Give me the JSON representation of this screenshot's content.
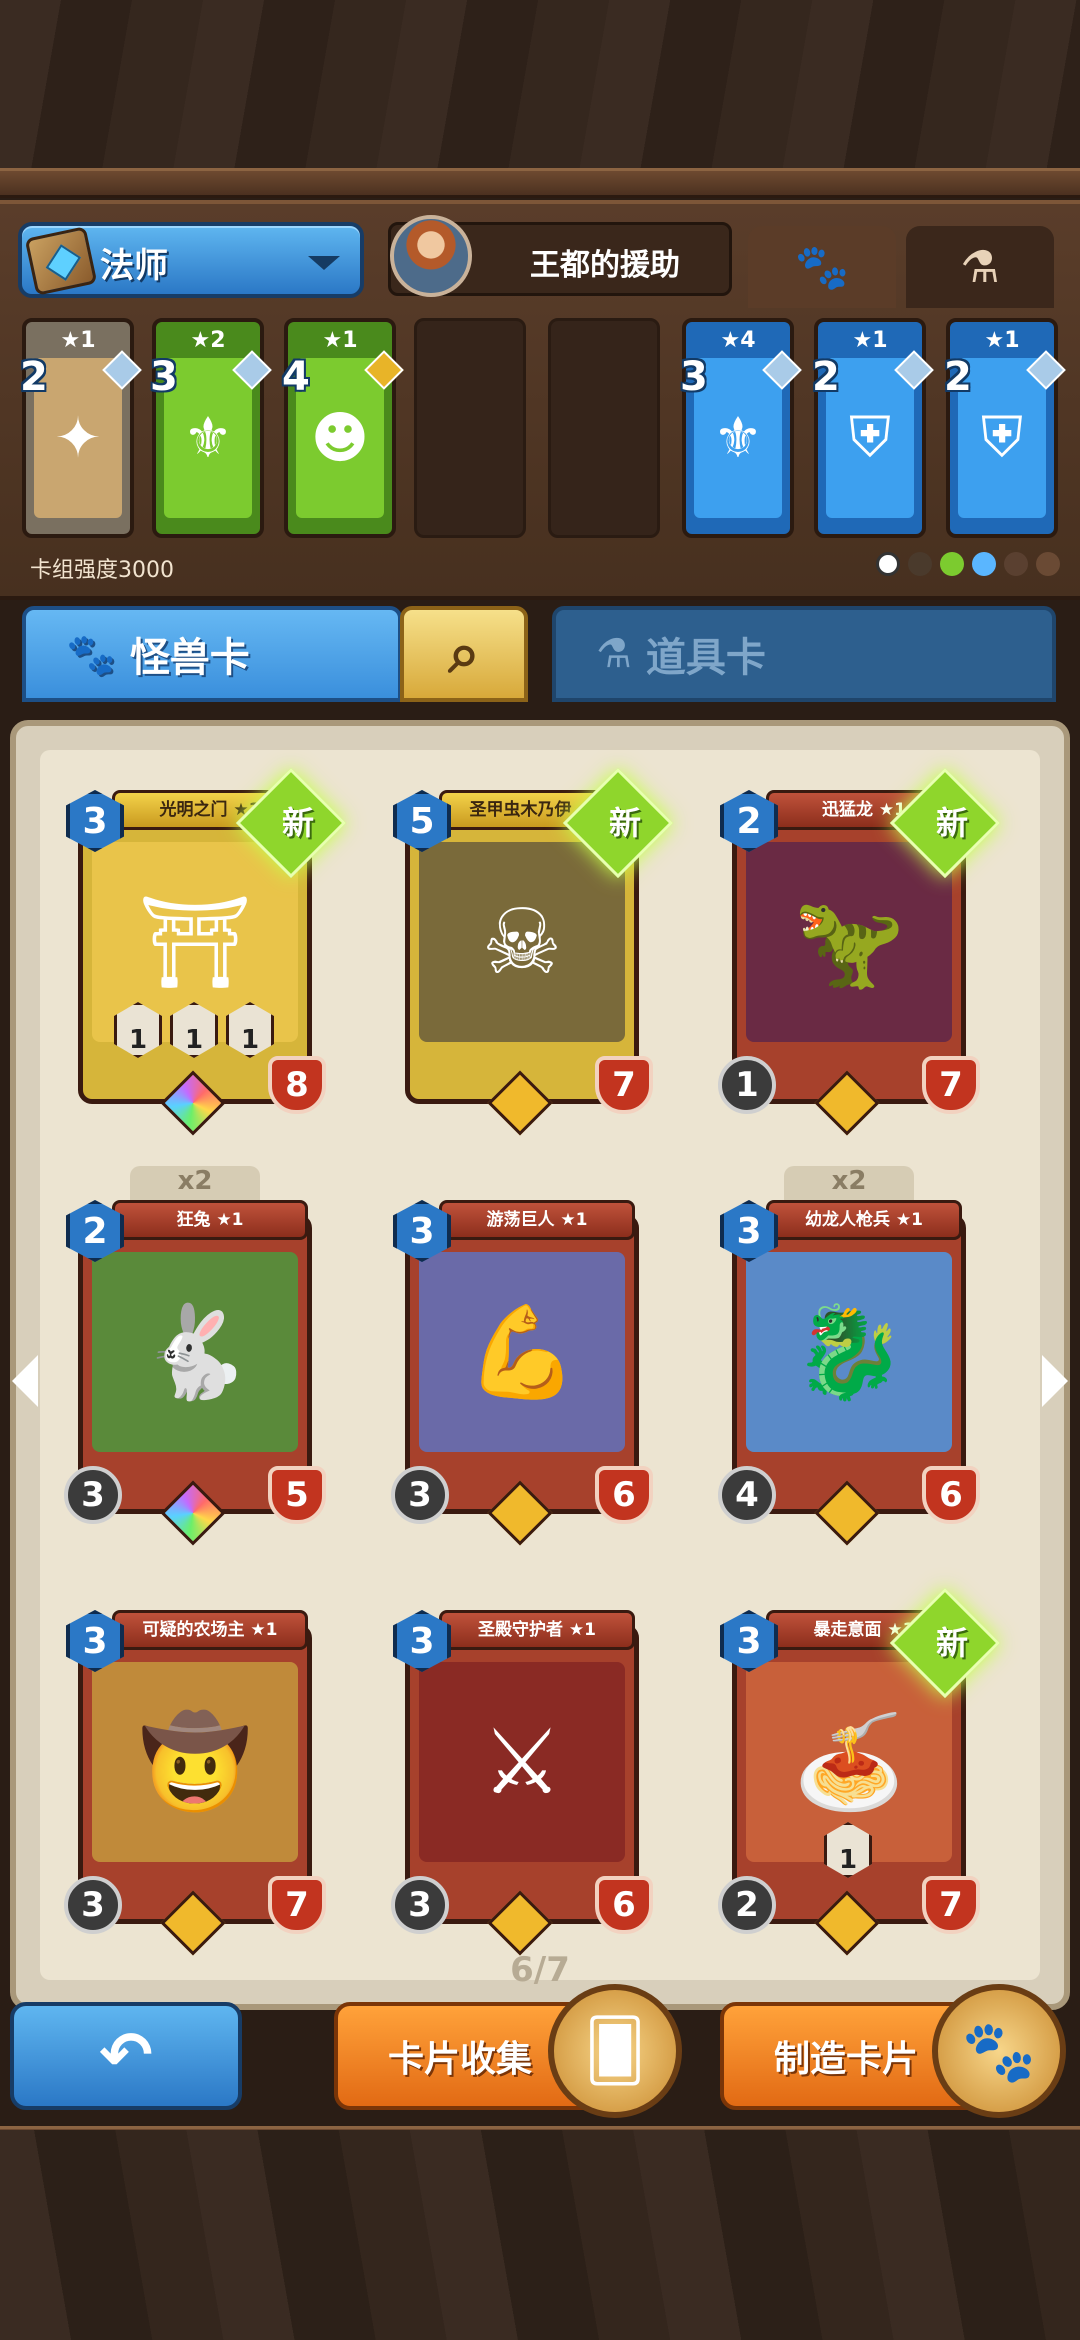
{
  "deck": {
    "class_label": "法师",
    "hero_name": "王都的援助",
    "strength_label": "卡组强度3000",
    "filter_tabs": [
      {
        "icon": "paw-icon"
      },
      {
        "icon": "flask-icon"
      }
    ],
    "cards": [
      {
        "cost": "2",
        "stars": "★1",
        "rarity": "common",
        "gem": "silver",
        "icon": "shuriken-icon"
      },
      {
        "cost": "3",
        "stars": "★2",
        "rarity": "uncommon",
        "gem": "silver",
        "icon": "banner-icon"
      },
      {
        "cost": "4",
        "stars": "★1",
        "rarity": "uncommon",
        "gem": "gold",
        "icon": "monster-head-icon"
      },
      {
        "cost": "3",
        "stars": "★4",
        "rarity": "rare",
        "gem": "silver",
        "icon": "banner-icon"
      },
      {
        "cost": "2",
        "stars": "★1",
        "rarity": "rare",
        "gem": "silver",
        "icon": "armor-icon"
      },
      {
        "cost": "2",
        "stars": "★1",
        "rarity": "rare",
        "gem": "silver",
        "icon": "armor-icon"
      }
    ],
    "element_colors": [
      "#ffffff",
      "#4a3a2c",
      "#7ccb2f",
      "#5ab6ff",
      "#5a4030",
      "#6a4a34"
    ]
  },
  "categories": {
    "monster_label": "怪兽卡",
    "item_label": "道具卡"
  },
  "collection": {
    "cards": [
      {
        "name": "光明之门 ★1",
        "cost": "3",
        "hp": "8",
        "frame": "gold",
        "new": true,
        "rarity": "rainbow",
        "skills": [
          "1",
          "1",
          "1"
        ]
      },
      {
        "name": "圣甲虫木乃伊 ★1",
        "cost": "5",
        "hp": "7",
        "frame": "gold",
        "new": true,
        "rarity": "gold",
        "skills": []
      },
      {
        "name": "迅猛龙 ★1",
        "cost": "2",
        "atk": "1",
        "hp": "7",
        "frame": "red",
        "new": true,
        "rarity": "gold"
      },
      {
        "name": "狂兔 ★1",
        "cost": "2",
        "atk": "3",
        "hp": "5",
        "frame": "red",
        "dup": "x2",
        "rarity": "rainbow"
      },
      {
        "name": "游荡巨人 ★1",
        "cost": "3",
        "atk": "3",
        "hp": "6",
        "frame": "red",
        "rarity": "gold"
      },
      {
        "name": "幼龙人枪兵 ★1",
        "cost": "3",
        "atk": "4",
        "hp": "6",
        "frame": "red",
        "dup": "x2",
        "rarity": "gold"
      },
      {
        "name": "可疑的农场主 ★1",
        "cost": "3",
        "atk": "3",
        "hp": "7",
        "frame": "red",
        "rarity": "gold"
      },
      {
        "name": "圣殿守护者 ★1",
        "cost": "3",
        "atk": "3",
        "hp": "6",
        "frame": "red",
        "rarity": "gold"
      },
      {
        "name": "暴走意面 ★1",
        "cost": "3",
        "atk": "2",
        "hp": "7",
        "frame": "red",
        "new": true,
        "rarity": "gold",
        "skills": [
          "1"
        ]
      }
    ],
    "new_label": "新",
    "page": "6/7"
  },
  "buttons": {
    "collect_label": "卡片收集",
    "craft_label": "制造卡片"
  }
}
